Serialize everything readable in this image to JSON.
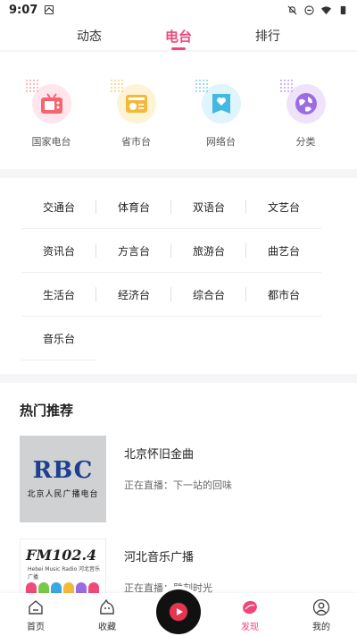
{
  "status": {
    "time": "9:07"
  },
  "tabs": [
    {
      "label": "动态"
    },
    {
      "label": "电台",
      "active": true
    },
    {
      "label": "排行"
    }
  ],
  "categories": [
    {
      "label": "国家电台",
      "icon": "tv-icon",
      "color": "#f57a91"
    },
    {
      "label": "省市台",
      "icon": "radio-icon",
      "color": "#f5b93a"
    },
    {
      "label": "网络台",
      "icon": "heart-card-icon",
      "color": "#43b8e0"
    },
    {
      "label": "分类",
      "icon": "globe-icon",
      "color": "#9b6de3"
    }
  ],
  "genres": [
    "交通台",
    "体育台",
    "双语台",
    "文艺台",
    "资讯台",
    "方言台",
    "旅游台",
    "曲艺台",
    "生活台",
    "经济台",
    "综合台",
    "都市台",
    "音乐台"
  ],
  "hot": {
    "title": "热门推荐",
    "stations": [
      {
        "name": "北京怀旧金曲",
        "live_prefix": "正在直播：",
        "program": "下一站的回味",
        "logo_text": "RBC",
        "logo_sub": "北京人民广播电台"
      },
      {
        "name": "河北音乐广播",
        "live_prefix": "正在直播：",
        "program": "雕刻时光",
        "logo_text": "FM102.4",
        "logo_sub": "Hebei Music Radio 河北音乐广播"
      }
    ]
  },
  "nav": [
    {
      "label": "首页",
      "icon": "home-icon"
    },
    {
      "label": "收藏",
      "icon": "favorite-icon"
    },
    {
      "label": "发现",
      "icon": "discover-icon",
      "active": true
    },
    {
      "label": "我的",
      "icon": "profile-icon"
    }
  ],
  "colors": {
    "accent": "#f0457a",
    "player": "#e8344e"
  }
}
